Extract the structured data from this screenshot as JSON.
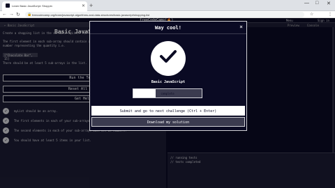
{
  "browser": {
    "tab_title": "Learn Basic JavaScript: Shoppin",
    "url": "freecodecamp.org/learn/javascript-algorithms-and-data-structures/basic-javascript/shopping-list",
    "minimize": "—",
    "maximize": "□",
    "close": "✕",
    "new_tab": "+",
    "back": "←",
    "forward": "→",
    "reload": "↻",
    "star": "☆",
    "menu": "⋮",
    "lock": "🔒"
  },
  "fcc": {
    "logo": "freeCodeCamp(🔥)",
    "nav": [
      "Menu",
      "Sign in"
    ]
  },
  "left_panel": {
    "top_label": "← Basic JavaScript",
    "title": "Basic JavaScript:",
    "desc_lines": [
      "Create a shopping list in the variable myList. The list should be",
      "The first element in each sub-array should contain a string with",
      "number representing the quantity i.e.",
      "There should be at least 5 sub-arrays in the list."
    ],
    "code_example": "[\"Chocolate Bar\", 15]",
    "buttons": [
      "Run the Tests",
      "Reset All Code",
      "Get Help"
    ]
  },
  "tests": [
    "myList should be an array.",
    "The first elements in each of your sub-arrays must all be strings.",
    "The second elements in each of your sub-arrays must all be numbers.",
    "You should have at least 5 items in your list."
  ],
  "editor": {
    "tabs": [
      "Preview",
      "Console"
    ],
    "console_lines": [
      "// running tests",
      "// tests completed"
    ]
  },
  "modal": {
    "title": "Way cool!",
    "close": "×",
    "cert_title": "Basic JavaScript",
    "progress_text": "complete",
    "progress_value": 0.33,
    "primary_button": "Submit and go to next challenge (Ctrl + Enter)",
    "secondary_button": "Download my solution"
  },
  "colors": {
    "bg": "#0a0a23",
    "panel": "#1b1b32",
    "text": "#d0d0d5"
  }
}
